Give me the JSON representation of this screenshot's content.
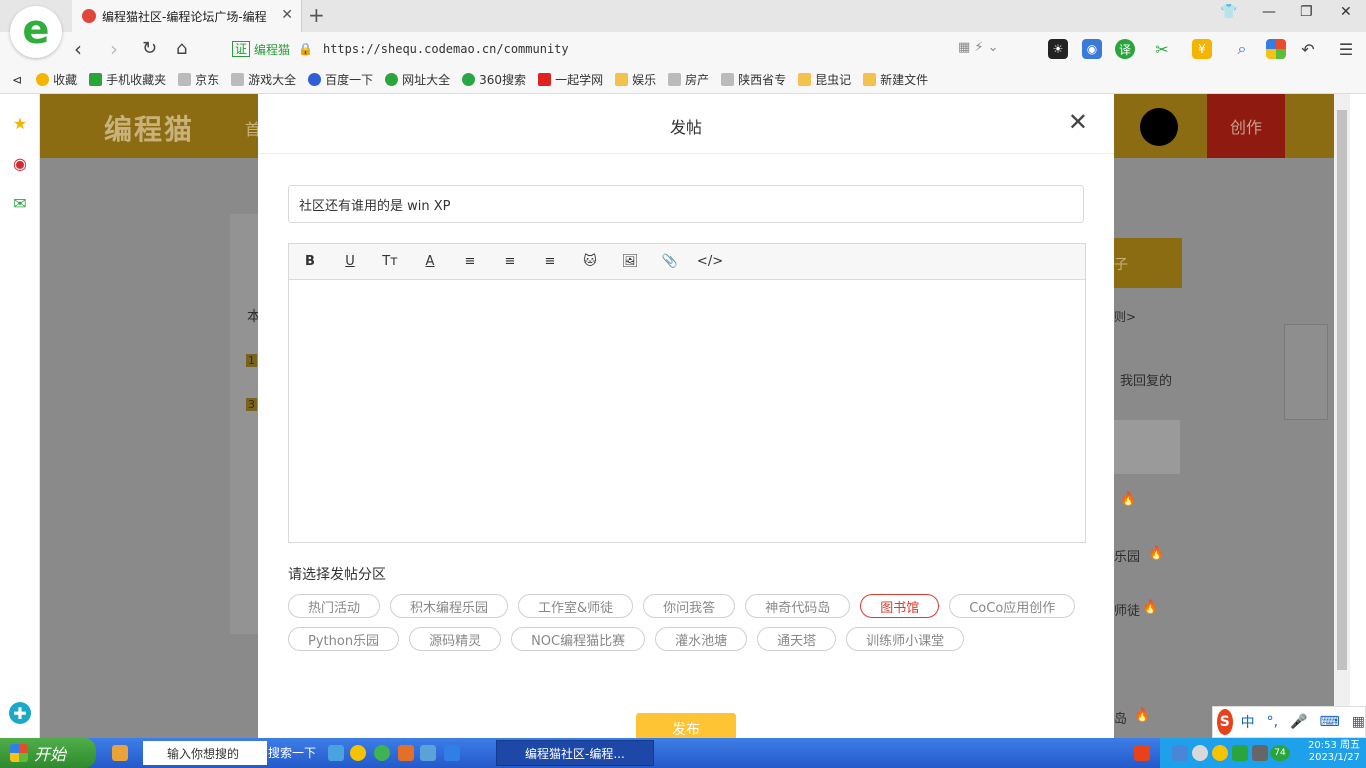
{
  "browser": {
    "tab_title": "编程猫社区-编程论坛广场-编程",
    "tab_close": "✕",
    "new_tab": "+",
    "cert_label": "证",
    "cert_name": "编程猫",
    "url": "https://shequ.codemao.cn/community",
    "window_controls": [
      "minimize",
      "restore",
      "close"
    ]
  },
  "bookmarks": [
    {
      "label": "收藏",
      "icon": "star-icon",
      "color": "#f5b400"
    },
    {
      "label": "手机收藏夹",
      "icon": "phone-icon",
      "color": "#2aa53b"
    },
    {
      "label": "京东",
      "icon": "page-icon",
      "color": "#bbbbbb"
    },
    {
      "label": "游戏大全",
      "icon": "page-icon",
      "color": "#bbbbbb"
    },
    {
      "label": "百度一下",
      "icon": "baidu-icon",
      "color": "#2f5fd6"
    },
    {
      "label": "网址大全",
      "icon": "globe-icon",
      "color": "#2aa53b"
    },
    {
      "label": "360搜索",
      "icon": "search360-icon",
      "color": "#27a745"
    },
    {
      "label": "一起学网",
      "icon": "play-icon",
      "color": "#e02020"
    },
    {
      "label": "娱乐",
      "icon": "folder-icon",
      "color": "#f2c14e"
    },
    {
      "label": "房产",
      "icon": "page-icon",
      "color": "#bbbbbb"
    },
    {
      "label": "陕西省专",
      "icon": "page-icon",
      "color": "#bbbbbb"
    },
    {
      "label": "昆虫记",
      "icon": "folder-icon",
      "color": "#f2c14e"
    },
    {
      "label": "新建文件",
      "icon": "folder-icon",
      "color": "#f2c14e"
    }
  ],
  "background_page": {
    "logo": "编程猫",
    "nav_first": "首",
    "create": "创作",
    "left_labels": [
      "本",
      "1",
      "3"
    ],
    "right_labels": [
      "子",
      "则>",
      "我回复的",
      "乐园",
      "师徒",
      "岛"
    ]
  },
  "modal": {
    "title": "发帖",
    "close": "✕",
    "post_title_value": "社区还有谁用的是 win XP",
    "toolbar": [
      {
        "name": "bold-button",
        "glyph": "B"
      },
      {
        "name": "underline-button",
        "glyph": "U"
      },
      {
        "name": "font-size-button",
        "glyph": "Tт"
      },
      {
        "name": "font-color-button",
        "glyph": "A"
      },
      {
        "name": "align-left-button",
        "glyph": "≡"
      },
      {
        "name": "align-center-button",
        "glyph": "≡"
      },
      {
        "name": "align-right-button",
        "glyph": "≡"
      },
      {
        "name": "codemao-emoji-button",
        "glyph": "🐱"
      },
      {
        "name": "insert-image-button",
        "glyph": "🖼"
      },
      {
        "name": "attach-file-button",
        "glyph": "📎"
      },
      {
        "name": "insert-code-button",
        "glyph": "</>"
      }
    ],
    "section_label": "请选择发帖分区",
    "categories": [
      {
        "label": "热门活动",
        "selected": false
      },
      {
        "label": "积木编程乐园",
        "selected": false
      },
      {
        "label": "工作室&师徒",
        "selected": false
      },
      {
        "label": "你问我答",
        "selected": false
      },
      {
        "label": "神奇代码岛",
        "selected": false
      },
      {
        "label": "图书馆",
        "selected": true
      },
      {
        "label": "CoCo应用创作",
        "selected": false
      },
      {
        "label": "Python乐园",
        "selected": false
      },
      {
        "label": "源码精灵",
        "selected": false
      },
      {
        "label": "NOC编程猫比赛",
        "selected": false
      },
      {
        "label": "灌水池塘",
        "selected": false
      },
      {
        "label": "通天塔",
        "selected": false
      },
      {
        "label": "训练师小课堂",
        "selected": false
      }
    ],
    "publish": "发布"
  },
  "taskbar": {
    "start": "开始",
    "search_placeholder": "输入你想搜的",
    "search_button": "搜索一下",
    "active_app": "编程猫社区-编程...",
    "clock_time": "20:53 周五",
    "clock_date": "2023/1/27",
    "tray_badge": "74"
  },
  "ime": {
    "mode": "中",
    "punct": "°,"
  },
  "colors": {
    "accent": "#fec433",
    "selected_tag": "#e0392d",
    "header_dim": "#8b6c12"
  }
}
